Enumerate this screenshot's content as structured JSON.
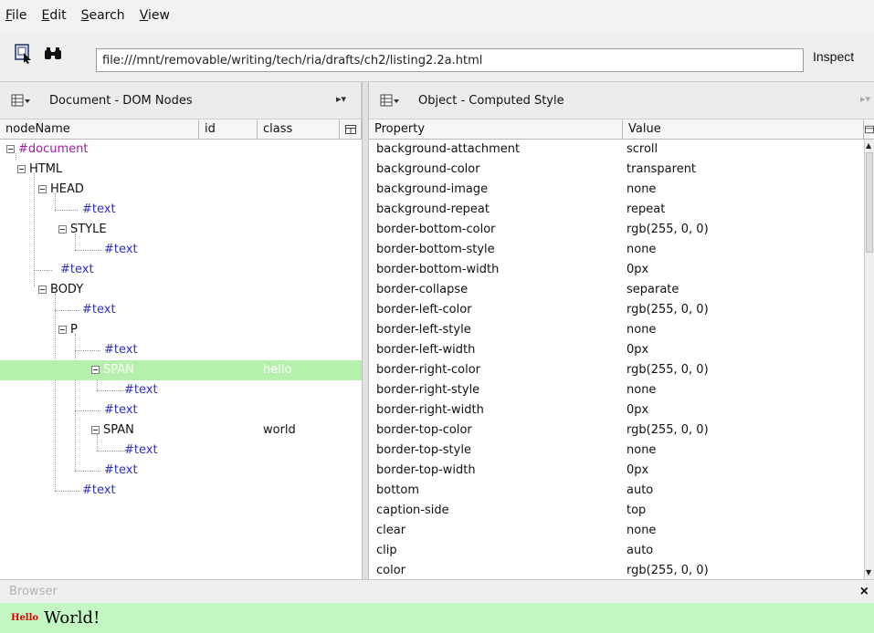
{
  "menu": {
    "items": [
      {
        "label": "File",
        "mnemonic": "F",
        "rest": "ile"
      },
      {
        "label": "Edit",
        "mnemonic": "E",
        "rest": "dit"
      },
      {
        "label": "Search",
        "mnemonic": "S",
        "rest": "earch"
      },
      {
        "label": "View",
        "mnemonic": "V",
        "rest": "iew"
      }
    ]
  },
  "toolbar": {
    "url": "file:///mnt/removable/writing/tech/ria/drafts/ch2/listing2.2a.html",
    "inspect_label": "Inspect"
  },
  "left_panel": {
    "title": "Document - DOM Nodes",
    "columns": [
      "nodeName",
      "id",
      "class"
    ],
    "nodes": [
      {
        "name": "#document",
        "type": "doc",
        "toggle": true,
        "class": ""
      },
      {
        "name": "HTML",
        "type": "elem",
        "toggle": true,
        "class": ""
      },
      {
        "name": "HEAD",
        "type": "elem",
        "toggle": true,
        "class": ""
      },
      {
        "name": "#text",
        "type": "text",
        "toggle": false,
        "class": ""
      },
      {
        "name": "STYLE",
        "type": "elem",
        "toggle": true,
        "class": ""
      },
      {
        "name": "#text",
        "type": "text",
        "toggle": false,
        "class": ""
      },
      {
        "name": "#text",
        "type": "text",
        "toggle": false,
        "class": ""
      },
      {
        "name": "BODY",
        "type": "elem",
        "toggle": true,
        "class": ""
      },
      {
        "name": "#text",
        "type": "text",
        "toggle": false,
        "class": ""
      },
      {
        "name": "P",
        "type": "elem",
        "toggle": true,
        "class": ""
      },
      {
        "name": "#text",
        "type": "text",
        "toggle": false,
        "class": ""
      },
      {
        "name": "SPAN",
        "type": "elem",
        "toggle": true,
        "class": "hello",
        "selected": true
      },
      {
        "name": "#text",
        "type": "text",
        "toggle": false,
        "class": ""
      },
      {
        "name": "#text",
        "type": "text",
        "toggle": false,
        "class": ""
      },
      {
        "name": "SPAN",
        "type": "elem",
        "toggle": true,
        "class": "world"
      },
      {
        "name": "#text",
        "type": "text",
        "toggle": false,
        "class": ""
      },
      {
        "name": "#text",
        "type": "text",
        "toggle": false,
        "class": ""
      },
      {
        "name": "#text",
        "type": "text",
        "toggle": false,
        "class": ""
      }
    ]
  },
  "right_panel": {
    "title": "Object - Computed Style",
    "columns": [
      "Property",
      "Value"
    ],
    "rows": [
      {
        "property": "background-attachment",
        "value": "scroll"
      },
      {
        "property": "background-color",
        "value": "transparent"
      },
      {
        "property": "background-image",
        "value": "none"
      },
      {
        "property": "background-repeat",
        "value": "repeat"
      },
      {
        "property": "border-bottom-color",
        "value": "rgb(255, 0, 0)"
      },
      {
        "property": "border-bottom-style",
        "value": "none"
      },
      {
        "property": "border-bottom-width",
        "value": "0px"
      },
      {
        "property": "border-collapse",
        "value": "separate"
      },
      {
        "property": "border-left-color",
        "value": "rgb(255, 0, 0)"
      },
      {
        "property": "border-left-style",
        "value": "none"
      },
      {
        "property": "border-left-width",
        "value": "0px"
      },
      {
        "property": "border-right-color",
        "value": "rgb(255, 0, 0)"
      },
      {
        "property": "border-right-style",
        "value": "none"
      },
      {
        "property": "border-right-width",
        "value": "0px"
      },
      {
        "property": "border-top-color",
        "value": "rgb(255, 0, 0)"
      },
      {
        "property": "border-top-style",
        "value": "none"
      },
      {
        "property": "border-top-width",
        "value": "0px"
      },
      {
        "property": "bottom",
        "value": "auto"
      },
      {
        "property": "caption-side",
        "value": "top"
      },
      {
        "property": "clear",
        "value": "none"
      },
      {
        "property": "clip",
        "value": "auto"
      },
      {
        "property": "color",
        "value": "rgb(255, 0, 0)"
      }
    ]
  },
  "browser": {
    "label": "Browser",
    "close": "×",
    "hello_text": "Hello",
    "world_text": "World!"
  },
  "colors": {
    "selected_row": "#b5f0ad",
    "text_node": "#2f2fc0",
    "document_node": "#a020a0",
    "browser_pane": "#c3f7c3",
    "hello": "#e00000"
  }
}
